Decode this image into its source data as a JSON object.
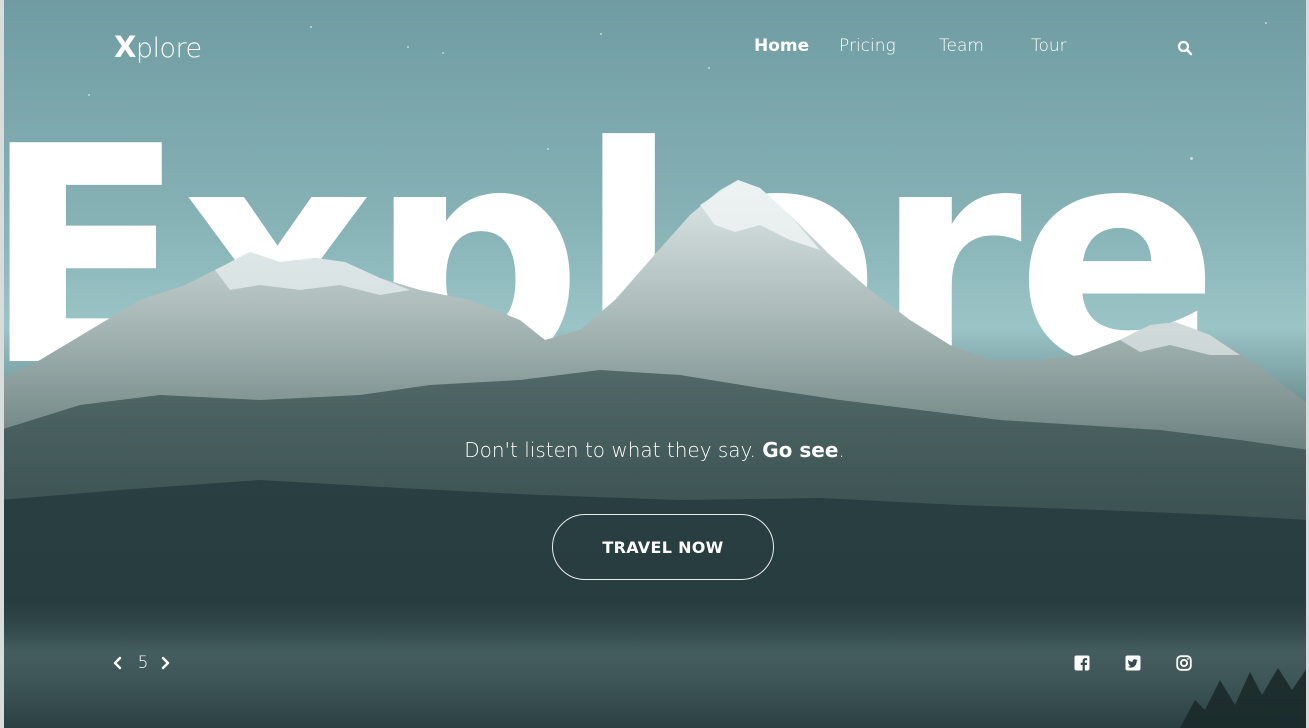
{
  "brand": {
    "logo_first": "X",
    "logo_rest": "plore"
  },
  "nav": {
    "items": [
      {
        "label": "Home",
        "active": true
      },
      {
        "label": "Pricing",
        "active": false
      },
      {
        "label": "Team",
        "active": false
      },
      {
        "label": "Tour",
        "active": false
      }
    ],
    "search_icon": "search-icon"
  },
  "hero": {
    "big_word": "Explore",
    "tagline_normal": "Don't listen to what they say. ",
    "tagline_bold": "Go see",
    "tagline_end": ".",
    "cta_label": "TRAVEL NOW"
  },
  "pager": {
    "current": "5",
    "prev_icon": "chevron-left-icon",
    "next_icon": "chevron-right-icon"
  },
  "social": {
    "icons": [
      "facebook-icon",
      "twitter-icon",
      "instagram-icon"
    ]
  },
  "colors": {
    "sky_top": "#6f9ca2",
    "sky_mid": "#9bc4c6",
    "valley": "#2b4446",
    "text": "#ffffff"
  }
}
